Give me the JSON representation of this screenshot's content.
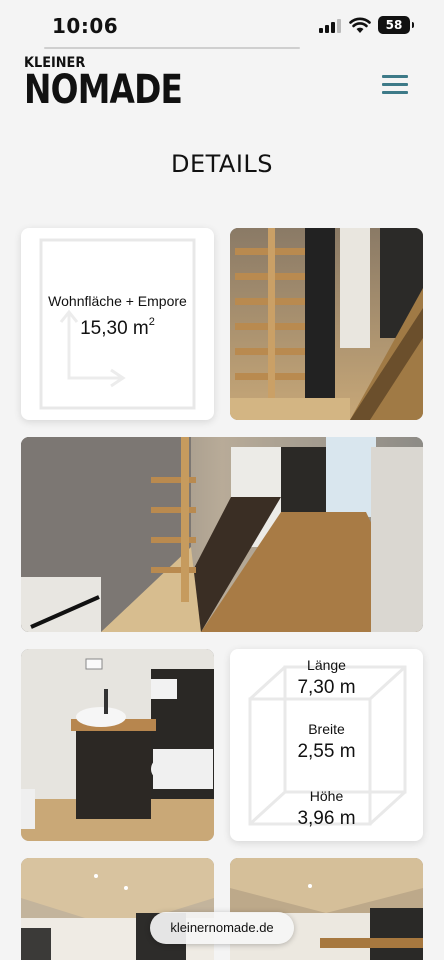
{
  "status_bar": {
    "time": "10:06",
    "battery": "58"
  },
  "header": {
    "logo_top": "KLEINER",
    "logo_main": "NOMADE"
  },
  "page": {
    "title": "DETAILS"
  },
  "area": {
    "label": "Wohnfläche + Empore",
    "value": "15,30 m",
    "unit_sup": "2"
  },
  "dimensions": [
    {
      "label": "Länge",
      "value": "7,30 m"
    },
    {
      "label": "Breite",
      "value": "2,55 m"
    },
    {
      "label": "Höhe",
      "value": "3,96 m"
    }
  ],
  "browser": {
    "url": "kleinernomade.de"
  },
  "icons": [
    "signal-icon",
    "wifi-icon",
    "battery-icon",
    "menu-icon"
  ],
  "colors": {
    "accent": "#3d7a88",
    "background": "#f4f4f4",
    "card": "#ffffff"
  }
}
